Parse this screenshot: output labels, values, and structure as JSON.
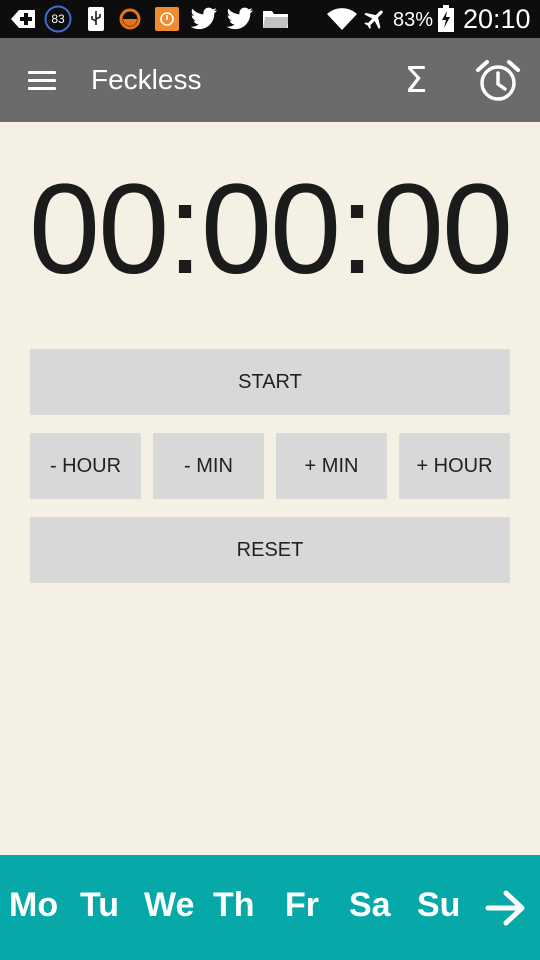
{
  "status_bar": {
    "notification_badge": "83",
    "battery_percent": "83%",
    "time": "20:10",
    "icons": [
      "plus-box-icon",
      "badge-circle-icon",
      "usb-icon",
      "orange-circle-icon",
      "orange-app-icon",
      "twitter-icon",
      "twitter-icon",
      "folder-icon",
      "wifi-icon",
      "airplane-icon",
      "battery-charging-icon"
    ]
  },
  "app_bar": {
    "title": "Feckless",
    "menu_icon": "hamburger-menu-icon",
    "sum_icon": "sigma-icon",
    "sum_symbol": "Σ",
    "alarm_icon": "alarm-clock-icon",
    "background": "#6b6b6b"
  },
  "timer": {
    "display": "00:00:00"
  },
  "controls": {
    "start_label": "START",
    "minus_hour_label": "- HOUR",
    "minus_min_label": "- MIN",
    "plus_min_label": "+ MIN",
    "plus_hour_label": "+ HOUR",
    "reset_label": "RESET",
    "button_color": "#d7d8d7"
  },
  "day_bar": {
    "days": [
      "Mo",
      "Tu",
      "We",
      "Th",
      "Fr",
      "Sa",
      "Su"
    ],
    "next_icon": "arrow-right-icon",
    "background": "#07a9a8"
  },
  "colors": {
    "page_background": "#f4f0e3",
    "status_bar": "#0d0d0d"
  }
}
